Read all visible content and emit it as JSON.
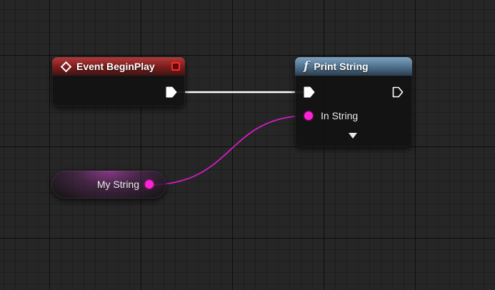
{
  "graph": {
    "nodes": {
      "event_begin_play": {
        "title": "Event BeginPlay",
        "header_color": "#8a2222",
        "icon": "event-diamond-icon",
        "delegate_pin_color": "#ff2a2a"
      },
      "print_string": {
        "title": "Print String",
        "header_color": "#5b7e9c",
        "icon": "function-icon",
        "icon_glyph": "f",
        "input_pins": [
          {
            "label": "In String",
            "type": "string",
            "color": "#ff22d4"
          }
        ],
        "advanced_display": "collapsed"
      },
      "my_string_variable": {
        "label": "My String",
        "type": "string",
        "color": "#ff22d4"
      }
    },
    "wires": [
      {
        "from": "Event BeginPlay.exec_out",
        "to": "Print String.exec_in",
        "color": "#ffffff"
      },
      {
        "from": "My String.value",
        "to": "Print String.In String",
        "color": "#d61bc6"
      }
    ]
  }
}
